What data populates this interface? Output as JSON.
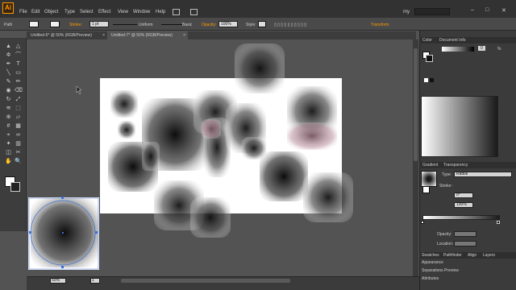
{
  "app": {
    "logo": "Ai"
  },
  "menu": [
    "File",
    "Edit",
    "Object",
    "Type",
    "Select",
    "Effect",
    "View",
    "Window",
    "Help"
  ],
  "workspace": {
    "label": "my",
    "search_placeholder": ""
  },
  "window_controls": {
    "minimize": "–",
    "maximize": "□",
    "close": "✕"
  },
  "control_bar": {
    "object_type": "Path",
    "stroke_label": "Stroke:",
    "stroke_weight": "1 pt",
    "stroke_profile": "Uniform",
    "brush": "Basic",
    "opacity_label": "Opacity:",
    "opacity_value": "100%",
    "style_label": "Style:",
    "transform_label": "Transform"
  },
  "tabs": [
    {
      "label": "Untitled-6* @ 50% (RGB/Preview)",
      "active": false
    },
    {
      "label": "Untitled-7* @ 50% (RGB/Preview)",
      "active": true
    }
  ],
  "tools": [
    "selection",
    "direct-selection",
    "magic-wand",
    "lasso",
    "pen",
    "type",
    "line",
    "rectangle",
    "paintbrush",
    "pencil",
    "blob-brush",
    "eraser",
    "rotate",
    "scale",
    "width",
    "free-transform",
    "shape-builder",
    "perspective",
    "mesh",
    "gradient",
    "eyedropper",
    "blend",
    "symbol-sprayer",
    "column-graph",
    "artboard",
    "slice",
    "hand",
    "zoom"
  ],
  "panels": {
    "color_tabs": [
      "Color",
      "Document Info"
    ],
    "color_value": "0",
    "color_percent": "%",
    "gradient_tabs": [
      "Gradient",
      "Transparency"
    ],
    "gradient_type_label": "Type:",
    "gradient_type": "Radial",
    "stroke_label": "Stroke:",
    "angle_value": "0°",
    "aspect_value": "100%",
    "opacity_label": "Opacity:",
    "location_label": "Location:",
    "bottom_tabs": [
      "Swatches",
      "Pathfinder",
      "Align",
      "Layers"
    ],
    "appearance": "Appearance",
    "separations": "Separations Preview",
    "attributes": "Attributes"
  },
  "status": {
    "zoom": "50%",
    "page": "1",
    "tool": "Selection"
  }
}
